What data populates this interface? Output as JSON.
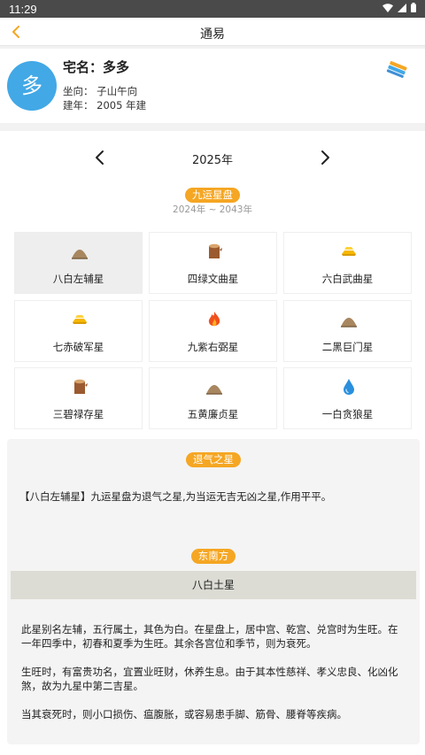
{
  "status": {
    "time": "11:29"
  },
  "appbar": {
    "title": "通易"
  },
  "house": {
    "avatar_char": "多",
    "name_label": "宅名：",
    "name_value": "多多",
    "orientation": "坐向：  子山午向",
    "built": "建年：  2005 年建"
  },
  "year": {
    "label": "2025年"
  },
  "period": {
    "title": "九运星盘",
    "range": "2024年 ~ 2043年"
  },
  "stars": [
    {
      "label": "八白左辅星",
      "icon": "earth-mound-icon",
      "selected": true
    },
    {
      "label": "四绿文曲星",
      "icon": "wood-stump-icon"
    },
    {
      "label": "六白武曲星",
      "icon": "gold-bars-icon"
    },
    {
      "label": "七赤破军星",
      "icon": "gold-bars-icon"
    },
    {
      "label": "九紫右弼星",
      "icon": "fire-icon"
    },
    {
      "label": "二黑巨门星",
      "icon": "earth-mound-icon"
    },
    {
      "label": "三碧禄存星",
      "icon": "wood-stump-icon"
    },
    {
      "label": "五黄廉贞星",
      "icon": "earth-mound-icon"
    },
    {
      "label": "一白贪狼星",
      "icon": "water-drop-icon"
    }
  ],
  "retreat": {
    "title": "退气之星",
    "text": "【八白左辅星】九运星盘为退气之星,为当运无吉无凶之星,作用平平。"
  },
  "direction": {
    "title": "东南方",
    "star": "八白土星",
    "p1": "此星别名左辅，五行属土，其色为白。在星盘上，居中宫、乾宫、兑宫时为生旺。在一年四季中，初春和夏季为生旺。其余各宫位和季节，则为衰死。",
    "p2": "生旺时，有富贵功名，宜置业旺财，休养生息。由于其本性慈祥、孝义忠良、化凶化煞，故为九星中第二吉星。",
    "p3": "当其衰死时，则小口损伤、瘟腹胀，或容易患手脚、筋骨、腰脊等疾病。"
  },
  "colors": {
    "accent": "#f5a623",
    "avatar": "#42a8e6"
  }
}
